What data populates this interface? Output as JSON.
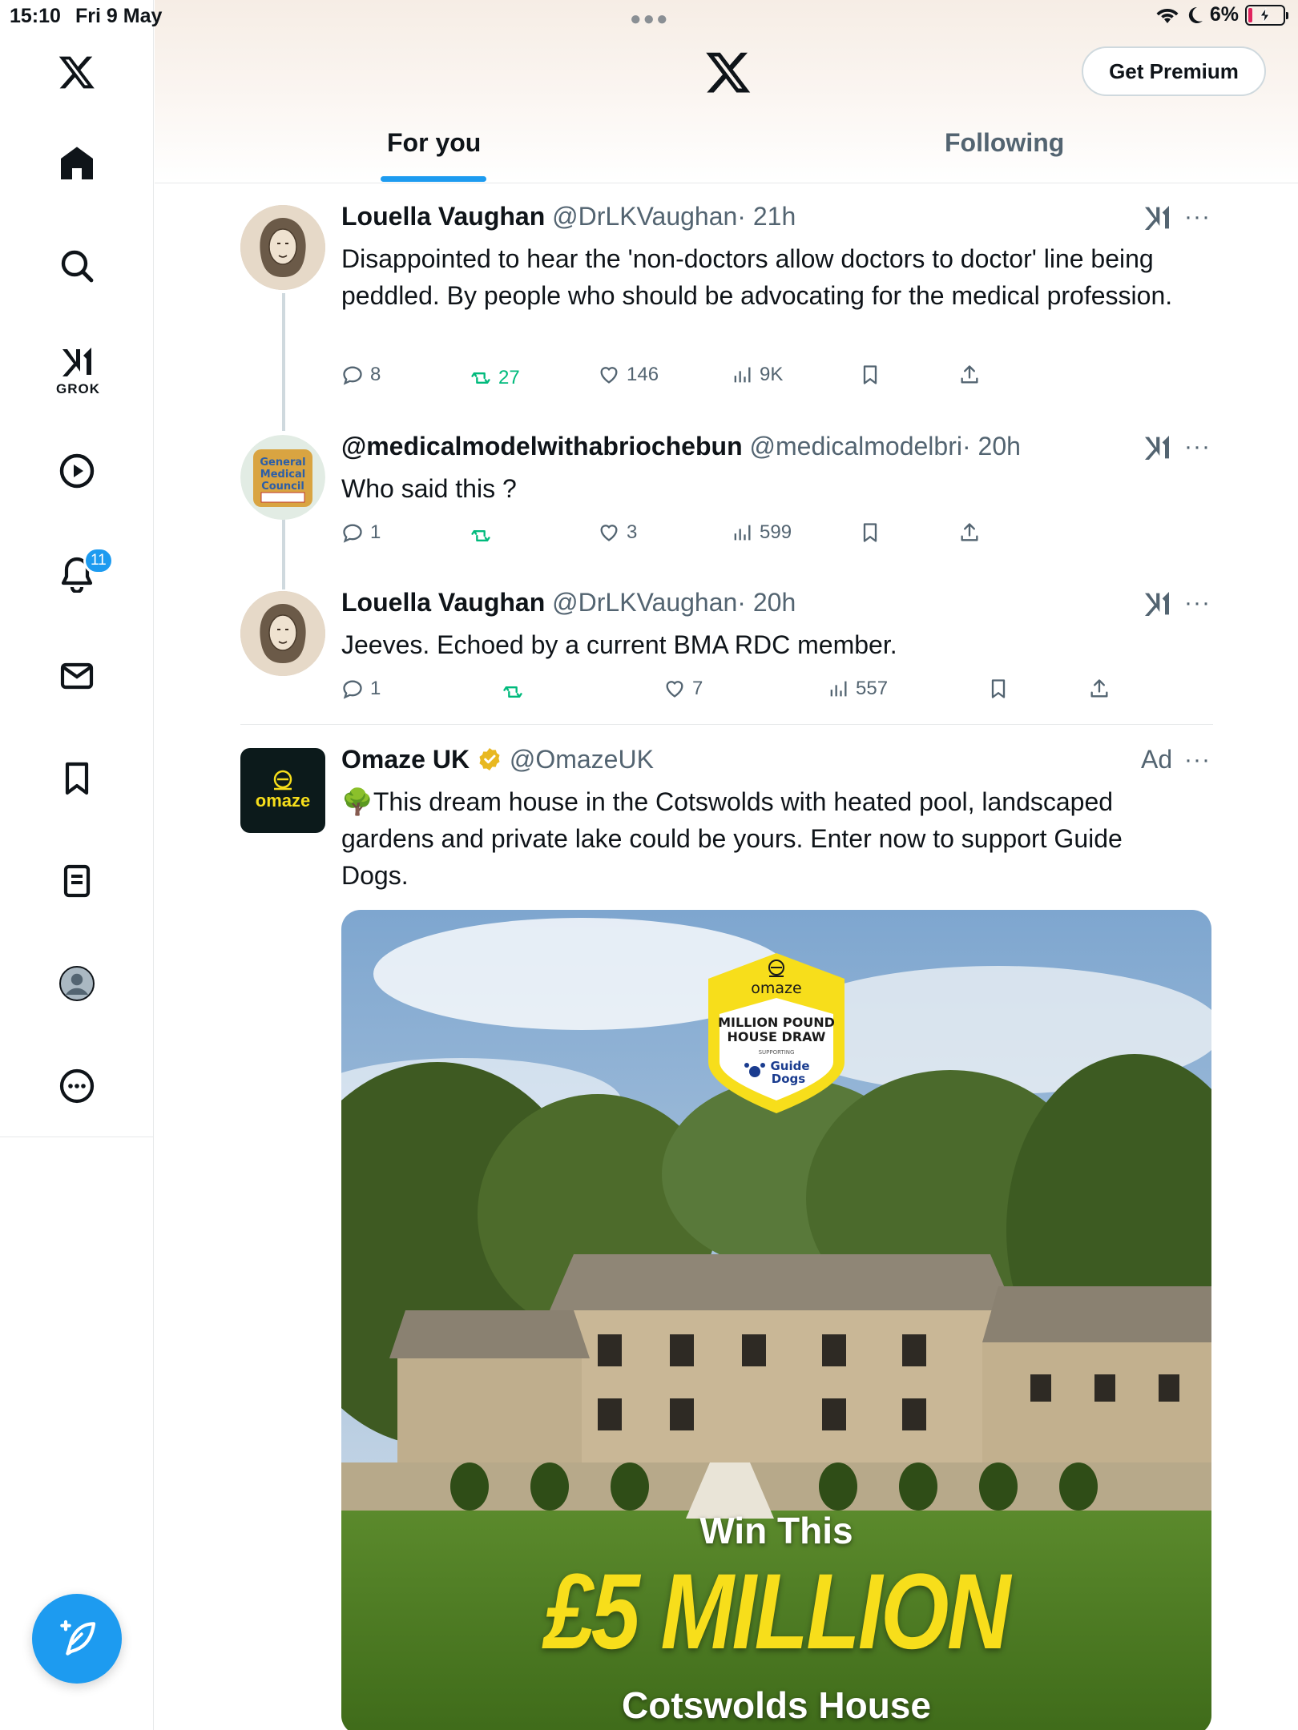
{
  "status_bar": {
    "time": "15:10",
    "date": "Fri 9 May",
    "battery": "6%"
  },
  "sidebar": {
    "grok_label": "GROK",
    "notifications_badge": "11",
    "items": [
      "x-logo",
      "home",
      "search",
      "grok",
      "videos",
      "notifications",
      "messages",
      "bookmarks",
      "lists",
      "profile",
      "more"
    ]
  },
  "header": {
    "premium_label": "Get Premium",
    "tabs": [
      {
        "label": "For you",
        "active": true
      },
      {
        "label": "Following",
        "active": false
      }
    ]
  },
  "tweets": [
    {
      "name": "Louella Vaughan",
      "handle": "@DrLKVaughan",
      "time": "· 21h",
      "text": "Disappointed to hear the 'non-doctors allow doctors to doctor' line being peddled. By people who should be advocating for the medical profession.",
      "replies": "8",
      "reposts": "27",
      "likes": "146",
      "views": "9K"
    },
    {
      "name": "@medicalmodelwithabriochebun",
      "handle": "@medicalmodelbri",
      "time": "· 20h",
      "text": "Who said this ?",
      "replies": "1",
      "reposts": "",
      "likes": "3",
      "views": "599"
    },
    {
      "name": "Louella Vaughan",
      "handle": "@DrLKVaughan",
      "time": "· 20h",
      "text": "Jeeves. Echoed by a current BMA RDC member.",
      "replies": "1",
      "reposts": "",
      "likes": "7",
      "views": "557"
    }
  ],
  "ad": {
    "name": "Omaze UK",
    "handle": "@OmazeUK",
    "label": "Ad",
    "avatar_text": "omaze",
    "text": "🌳This dream house in the Cotswolds with heated pool, landscaped gardens and private lake could be yours. Enter now to support Guide Dogs.",
    "image": {
      "badge_brand": "omaze",
      "badge_title_1": "MILLION POUND",
      "badge_title_2": "HOUSE DRAW",
      "badge_supporting": "SUPPORTING",
      "badge_charity_1": "Guide",
      "badge_charity_2": "Dogs",
      "win_text": "Win This",
      "amount_text": "£5 MILLION",
      "house_text": "Cotswolds House"
    }
  },
  "colors": {
    "accent": "#1d9bf0",
    "repost": "#00ba7c",
    "ad_yellow": "#f7de1b",
    "badge_blue": "#1d9bf0"
  }
}
